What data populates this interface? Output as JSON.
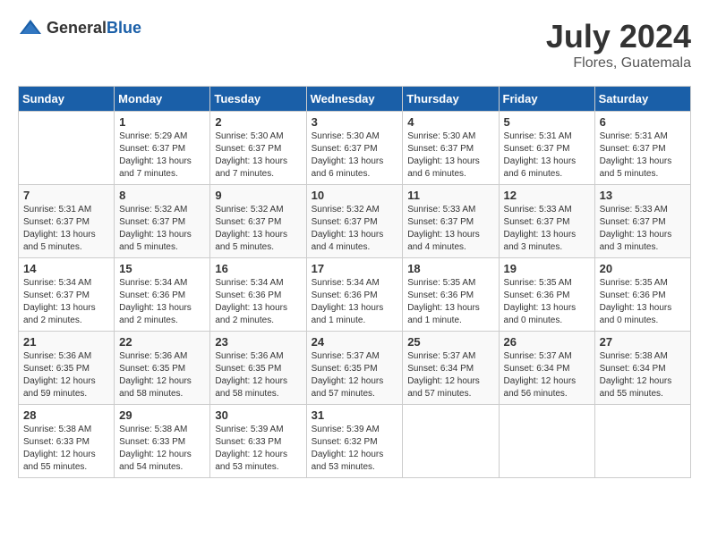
{
  "header": {
    "logo": {
      "general": "General",
      "blue": "Blue"
    },
    "title": "July 2024",
    "location": "Flores, Guatemala"
  },
  "calendar": {
    "days_of_week": [
      "Sunday",
      "Monday",
      "Tuesday",
      "Wednesday",
      "Thursday",
      "Friday",
      "Saturday"
    ],
    "weeks": [
      [
        {
          "day": "",
          "sunrise": "",
          "sunset": "",
          "daylight": ""
        },
        {
          "day": "1",
          "sunrise": "Sunrise: 5:29 AM",
          "sunset": "Sunset: 6:37 PM",
          "daylight": "Daylight: 13 hours and 7 minutes."
        },
        {
          "day": "2",
          "sunrise": "Sunrise: 5:30 AM",
          "sunset": "Sunset: 6:37 PM",
          "daylight": "Daylight: 13 hours and 7 minutes."
        },
        {
          "day": "3",
          "sunrise": "Sunrise: 5:30 AM",
          "sunset": "Sunset: 6:37 PM",
          "daylight": "Daylight: 13 hours and 6 minutes."
        },
        {
          "day": "4",
          "sunrise": "Sunrise: 5:30 AM",
          "sunset": "Sunset: 6:37 PM",
          "daylight": "Daylight: 13 hours and 6 minutes."
        },
        {
          "day": "5",
          "sunrise": "Sunrise: 5:31 AM",
          "sunset": "Sunset: 6:37 PM",
          "daylight": "Daylight: 13 hours and 6 minutes."
        },
        {
          "day": "6",
          "sunrise": "Sunrise: 5:31 AM",
          "sunset": "Sunset: 6:37 PM",
          "daylight": "Daylight: 13 hours and 5 minutes."
        }
      ],
      [
        {
          "day": "7",
          "sunrise": "Sunrise: 5:31 AM",
          "sunset": "Sunset: 6:37 PM",
          "daylight": "Daylight: 13 hours and 5 minutes."
        },
        {
          "day": "8",
          "sunrise": "Sunrise: 5:32 AM",
          "sunset": "Sunset: 6:37 PM",
          "daylight": "Daylight: 13 hours and 5 minutes."
        },
        {
          "day": "9",
          "sunrise": "Sunrise: 5:32 AM",
          "sunset": "Sunset: 6:37 PM",
          "daylight": "Daylight: 13 hours and 5 minutes."
        },
        {
          "day": "10",
          "sunrise": "Sunrise: 5:32 AM",
          "sunset": "Sunset: 6:37 PM",
          "daylight": "Daylight: 13 hours and 4 minutes."
        },
        {
          "day": "11",
          "sunrise": "Sunrise: 5:33 AM",
          "sunset": "Sunset: 6:37 PM",
          "daylight": "Daylight: 13 hours and 4 minutes."
        },
        {
          "day": "12",
          "sunrise": "Sunrise: 5:33 AM",
          "sunset": "Sunset: 6:37 PM",
          "daylight": "Daylight: 13 hours and 3 minutes."
        },
        {
          "day": "13",
          "sunrise": "Sunrise: 5:33 AM",
          "sunset": "Sunset: 6:37 PM",
          "daylight": "Daylight: 13 hours and 3 minutes."
        }
      ],
      [
        {
          "day": "14",
          "sunrise": "Sunrise: 5:34 AM",
          "sunset": "Sunset: 6:37 PM",
          "daylight": "Daylight: 13 hours and 2 minutes."
        },
        {
          "day": "15",
          "sunrise": "Sunrise: 5:34 AM",
          "sunset": "Sunset: 6:36 PM",
          "daylight": "Daylight: 13 hours and 2 minutes."
        },
        {
          "day": "16",
          "sunrise": "Sunrise: 5:34 AM",
          "sunset": "Sunset: 6:36 PM",
          "daylight": "Daylight: 13 hours and 2 minutes."
        },
        {
          "day": "17",
          "sunrise": "Sunrise: 5:34 AM",
          "sunset": "Sunset: 6:36 PM",
          "daylight": "Daylight: 13 hours and 1 minute."
        },
        {
          "day": "18",
          "sunrise": "Sunrise: 5:35 AM",
          "sunset": "Sunset: 6:36 PM",
          "daylight": "Daylight: 13 hours and 1 minute."
        },
        {
          "day": "19",
          "sunrise": "Sunrise: 5:35 AM",
          "sunset": "Sunset: 6:36 PM",
          "daylight": "Daylight: 13 hours and 0 minutes."
        },
        {
          "day": "20",
          "sunrise": "Sunrise: 5:35 AM",
          "sunset": "Sunset: 6:36 PM",
          "daylight": "Daylight: 13 hours and 0 minutes."
        }
      ],
      [
        {
          "day": "21",
          "sunrise": "Sunrise: 5:36 AM",
          "sunset": "Sunset: 6:35 PM",
          "daylight": "Daylight: 12 hours and 59 minutes."
        },
        {
          "day": "22",
          "sunrise": "Sunrise: 5:36 AM",
          "sunset": "Sunset: 6:35 PM",
          "daylight": "Daylight: 12 hours and 58 minutes."
        },
        {
          "day": "23",
          "sunrise": "Sunrise: 5:36 AM",
          "sunset": "Sunset: 6:35 PM",
          "daylight": "Daylight: 12 hours and 58 minutes."
        },
        {
          "day": "24",
          "sunrise": "Sunrise: 5:37 AM",
          "sunset": "Sunset: 6:35 PM",
          "daylight": "Daylight: 12 hours and 57 minutes."
        },
        {
          "day": "25",
          "sunrise": "Sunrise: 5:37 AM",
          "sunset": "Sunset: 6:34 PM",
          "daylight": "Daylight: 12 hours and 57 minutes."
        },
        {
          "day": "26",
          "sunrise": "Sunrise: 5:37 AM",
          "sunset": "Sunset: 6:34 PM",
          "daylight": "Daylight: 12 hours and 56 minutes."
        },
        {
          "day": "27",
          "sunrise": "Sunrise: 5:38 AM",
          "sunset": "Sunset: 6:34 PM",
          "daylight": "Daylight: 12 hours and 55 minutes."
        }
      ],
      [
        {
          "day": "28",
          "sunrise": "Sunrise: 5:38 AM",
          "sunset": "Sunset: 6:33 PM",
          "daylight": "Daylight: 12 hours and 55 minutes."
        },
        {
          "day": "29",
          "sunrise": "Sunrise: 5:38 AM",
          "sunset": "Sunset: 6:33 PM",
          "daylight": "Daylight: 12 hours and 54 minutes."
        },
        {
          "day": "30",
          "sunrise": "Sunrise: 5:39 AM",
          "sunset": "Sunset: 6:33 PM",
          "daylight": "Daylight: 12 hours and 53 minutes."
        },
        {
          "day": "31",
          "sunrise": "Sunrise: 5:39 AM",
          "sunset": "Sunset: 6:32 PM",
          "daylight": "Daylight: 12 hours and 53 minutes."
        },
        {
          "day": "",
          "sunrise": "",
          "sunset": "",
          "daylight": ""
        },
        {
          "day": "",
          "sunrise": "",
          "sunset": "",
          "daylight": ""
        },
        {
          "day": "",
          "sunrise": "",
          "sunset": "",
          "daylight": ""
        }
      ]
    ]
  }
}
